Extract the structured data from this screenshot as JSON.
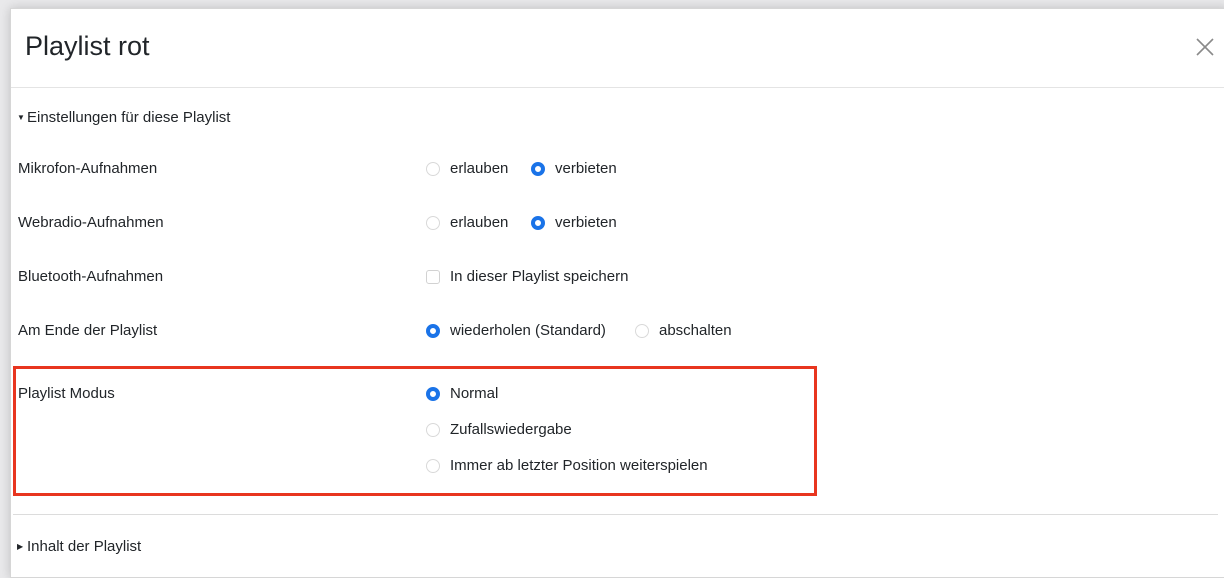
{
  "modal": {
    "title": "Playlist rot",
    "close_icon": "close-icon"
  },
  "settings_section": {
    "toggle_label": "Einstellungen für diese Playlist",
    "expanded": true,
    "rows": {
      "mic": {
        "label": "Mikrofon-Aufnahmen",
        "options": [
          "erlauben",
          "verbieten"
        ],
        "selected": "verbieten"
      },
      "webradio": {
        "label": "Webradio-Aufnahmen",
        "options": [
          "erlauben",
          "verbieten"
        ],
        "selected": "verbieten"
      },
      "bluetooth": {
        "label": "Bluetooth-Aufnahmen",
        "checkbox_label": "In dieser Playlist speichern",
        "checked": false
      },
      "end": {
        "label": "Am Ende der Playlist",
        "options": [
          "wiederholen (Standard)",
          "abschalten"
        ],
        "selected": "wiederholen (Standard)"
      },
      "mode": {
        "label": "Playlist Modus",
        "options": [
          "Normal",
          "Zufallswiedergabe",
          "Immer ab letzter Position weiterspielen"
        ],
        "selected": "Normal"
      }
    }
  },
  "content_section": {
    "toggle_label": "Inhalt der Playlist",
    "expanded": false
  },
  "colors": {
    "accent": "#1a73e8",
    "highlight": "#e8351f",
    "text": "#212529"
  }
}
